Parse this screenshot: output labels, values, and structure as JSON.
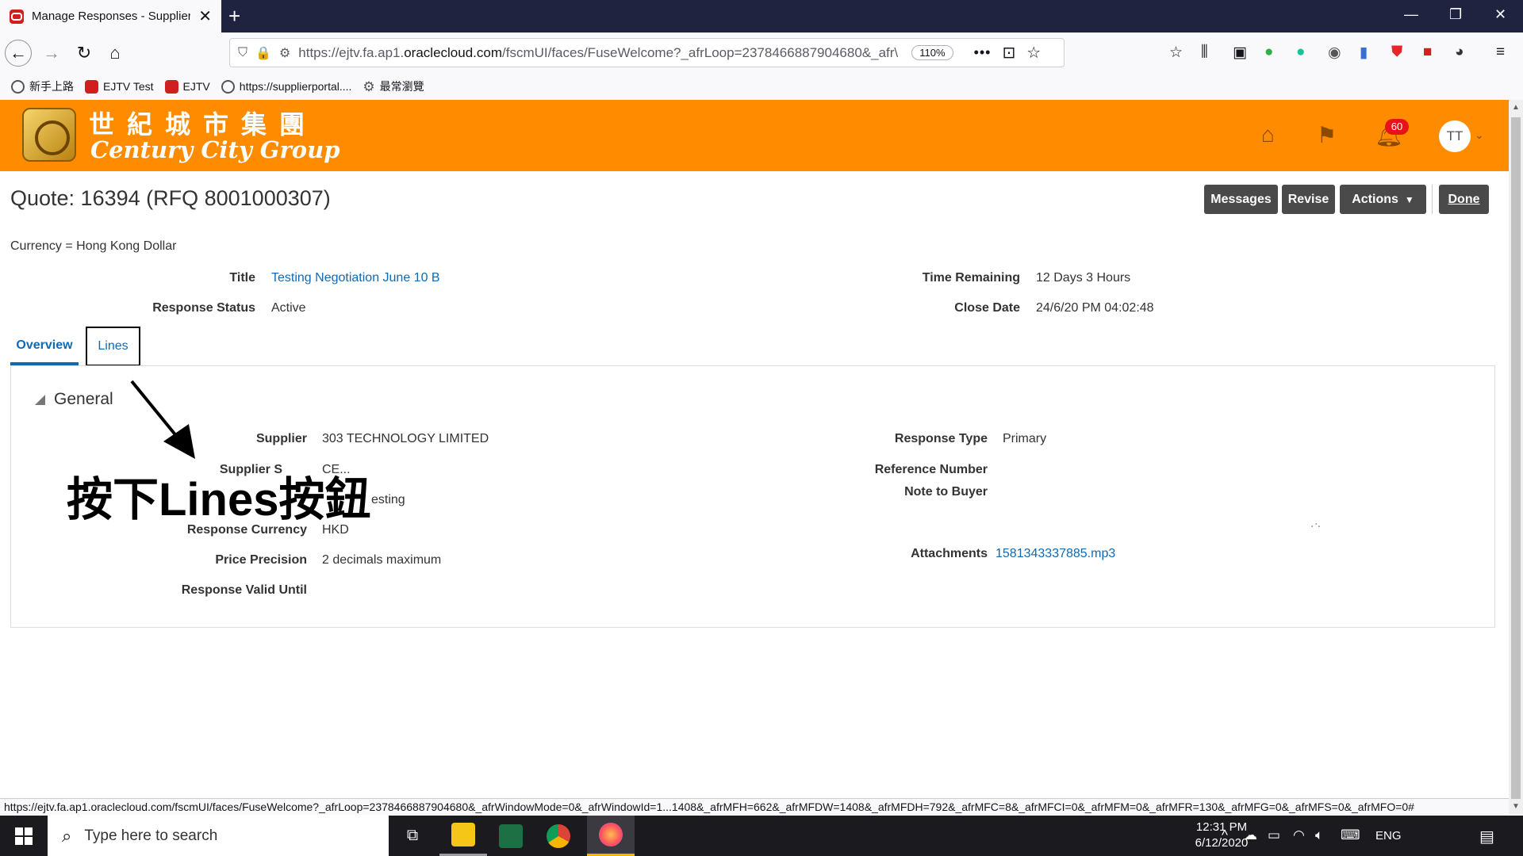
{
  "browser": {
    "tab_title": "Manage Responses - Supplier P",
    "url_host_prefix": "https://ejtv.fa.ap1.",
    "url_host_domain": "oraclecloud.com",
    "url_path": "/fscmUI/faces/FuseWelcome?_afrLoop=2378466887904680&_afr\\",
    "zoom": "110%",
    "bookmarks": [
      "新手上路",
      "EJTV Test",
      "EJTV",
      "https://supplierportal....",
      "最常瀏覽"
    ],
    "status_url": "https://ejtv.fa.ap1.oraclecloud.com/fscmUI/faces/FuseWelcome?_afrLoop=2378466887904680&_afrWindowMode=0&_afrWindowId=1...1408&_afrMFH=662&_afrMFDW=1408&_afrMFDH=792&_afrMFC=8&_afrMFCI=0&_afrMFM=0&_afrMFR=130&_afrMFG=0&_afrMFS=0&_afrMFO=0#"
  },
  "header": {
    "logo_cn": "世紀城市集團",
    "logo_en": "Century City Group",
    "notification_count": "60",
    "avatar_initials": "TT",
    "brand_color": "#ff8c00"
  },
  "page": {
    "title": "Quote: 16394 (RFQ 8001000307)",
    "buttons": {
      "messages": "Messages",
      "revise": "Revise",
      "actions": "Actions",
      "done": "Done"
    },
    "currency": "Currency = Hong Kong Dollar",
    "summary": {
      "title_label": "Title",
      "title_value": "Testing Negotiation June 10 B",
      "status_label": "Response Status",
      "status_value": "Active",
      "time_label": "Time Remaining",
      "time_value": "12 Days 3 Hours",
      "close_label": "Close Date",
      "close_value": "24/6/20 PM 04:02:48"
    },
    "tabs": [
      "Overview",
      "Lines"
    ],
    "section": "General",
    "general": {
      "supplier_label": "Supplier",
      "supplier_value": "303 TECHNOLOGY LIMITED",
      "supplier_site_label": "Supplier S",
      "supplier_site_value": "CE...",
      "row3_value": "esting",
      "currency_label": "Response Currency",
      "currency_value": "HKD",
      "precision_label": "Price Precision",
      "precision_value": "2 decimals maximum",
      "valid_label": "Response Valid Until",
      "type_label": "Response Type",
      "type_value": "Primary",
      "ref_label": "Reference Number",
      "note_label": "Note to Buyer",
      "attach_label": "Attachments",
      "attach_value": "1581343337885.mp3"
    },
    "annotation": "按下Lines按鈕"
  },
  "taskbar": {
    "search_placeholder": "Type here to search",
    "lang": "ENG",
    "time": "12:31 PM",
    "date": "6/12/2020"
  }
}
